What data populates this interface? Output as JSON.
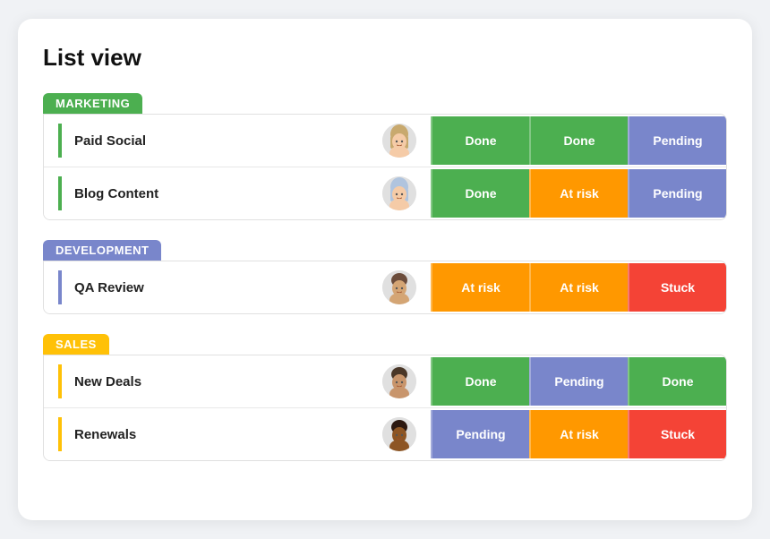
{
  "page": {
    "title": "List view"
  },
  "groups": [
    {
      "id": "marketing",
      "label": "MARKETING",
      "headerColor": "#4caf50",
      "stripColor": "#4caf50",
      "rows": [
        {
          "name": "Paid Social",
          "avatar": "female1",
          "statuses": [
            {
              "label": "Done",
              "type": "done"
            },
            {
              "label": "Done",
              "type": "done"
            },
            {
              "label": "Pending",
              "type": "pending"
            }
          ]
        },
        {
          "name": "Blog Content",
          "avatar": "female2",
          "statuses": [
            {
              "label": "Done",
              "type": "done"
            },
            {
              "label": "At risk",
              "type": "at-risk"
            },
            {
              "label": "Pending",
              "type": "pending"
            }
          ]
        }
      ]
    },
    {
      "id": "development",
      "label": "DEVELOPMENT",
      "headerColor": "#7986cb",
      "stripColor": "#7986cb",
      "rows": [
        {
          "name": "QA Review",
          "avatar": "male1",
          "statuses": [
            {
              "label": "At risk",
              "type": "at-risk"
            },
            {
              "label": "At risk",
              "type": "at-risk"
            },
            {
              "label": "Stuck",
              "type": "stuck"
            }
          ]
        }
      ]
    },
    {
      "id": "sales",
      "label": "SALES",
      "headerColor": "#ffc107",
      "stripColor": "#ffc107",
      "rows": [
        {
          "name": "New Deals",
          "avatar": "male2",
          "statuses": [
            {
              "label": "Done",
              "type": "done"
            },
            {
              "label": "Pending",
              "type": "pending"
            },
            {
              "label": "Done",
              "type": "done"
            }
          ]
        },
        {
          "name": "Renewals",
          "avatar": "male3",
          "statuses": [
            {
              "label": "Pending",
              "type": "pending"
            },
            {
              "label": "At risk",
              "type": "at-risk"
            },
            {
              "label": "Stuck",
              "type": "stuck"
            }
          ]
        }
      ]
    }
  ]
}
